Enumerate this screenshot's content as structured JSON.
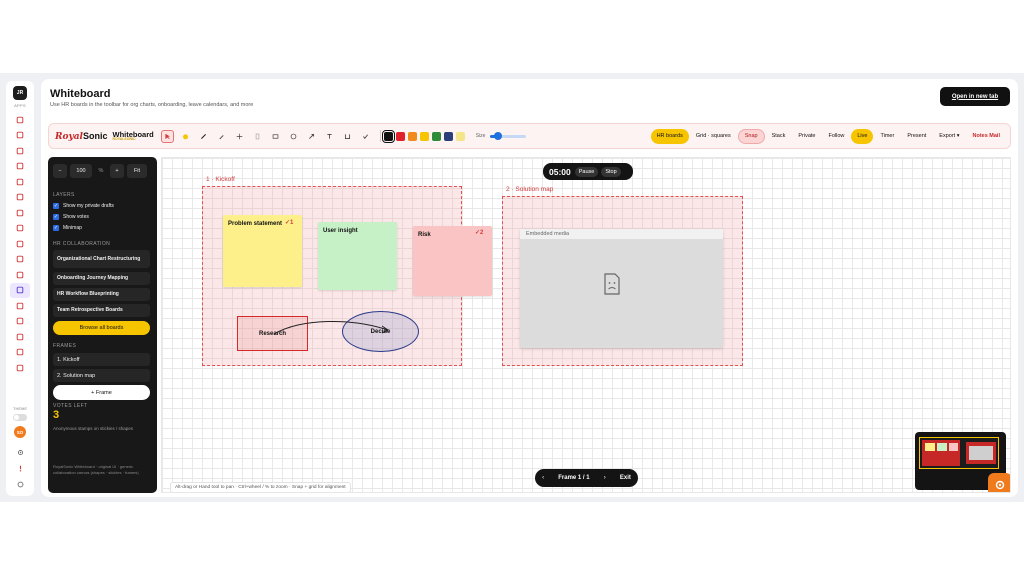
{
  "rail": {
    "avatar": "JR",
    "apps_label": "APPS",
    "icons": [
      "mail-icon",
      "users-icon",
      "calendar-icon",
      "checkbox-icon",
      "bell-icon",
      "inbox-icon",
      "cloud-icon",
      "lock-icon",
      "team-icon",
      "document-icon",
      "list-icon",
      "whiteboard-icon",
      "video-icon",
      "chart-icon",
      "help-icon",
      "grid-icon",
      "notes-icon"
    ],
    "active_index": 11,
    "theme_label": "THEME",
    "user_initials": "SO"
  },
  "header": {
    "title": "Whiteboard",
    "subtitle": "Use HR boards in the toolbar for org charts, onboarding, leave calendars, and more",
    "open_new_tab": "Open in new tab"
  },
  "toolbar": {
    "logo_royal": "Royal",
    "logo_sonic": "Sonic",
    "brand_title": "Whiteboard",
    "brand_sub": "ROYALSONIC",
    "size_label": "Size",
    "size_value": 0.15,
    "swatches": [
      "#111111",
      "#e0202a",
      "#f08a1c",
      "#f7c400",
      "#2e8b3a",
      "#2a3f7a",
      "#f5e58a"
    ],
    "active_swatch": 0,
    "buttons": {
      "hr_boards": "HR boards",
      "grid": "Grid · squares",
      "snap": "Snap",
      "stack": "Stack",
      "private": "Private",
      "follow": "Follow",
      "live": "Live",
      "timer": "Timer",
      "present": "Present",
      "export": "Export ▾",
      "notes_mail": "Notes Mail"
    }
  },
  "sidebar": {
    "zoom_minus": "−",
    "zoom_value": "100",
    "zoom_pct": "%",
    "zoom_plus": "+",
    "fit": "Fit",
    "layers_label": "LAYERS",
    "layers": [
      "Show my private drafts",
      "Show votes",
      "Minimap"
    ],
    "hr_label": "HR COLLABORATION",
    "templates": [
      "Organizational Chart Restructuring",
      "Onboarding Journey Mapping",
      "HR Workflow Blueprinting",
      "Team Retrospective Boards"
    ],
    "browse": "Browse all boards",
    "frames_label": "FRAMES",
    "frames": [
      "1. Kickoff",
      "2. Solution map"
    ],
    "add_frame": "+ Frame",
    "votes_label": "VOTES LEFT",
    "votes_left": "3",
    "votes_help": "Anonymous stamps on stickies / shapes",
    "footer": "RoyalSonic Whiteboard · original UI · generic collaboration canvas (shapes · stickies · frames)"
  },
  "canvas": {
    "timer": "05:00",
    "pause": "Pause",
    "stop": "Stop",
    "frame1_label": "1 · Kickoff",
    "frame2_label": "2 · Solution map",
    "stickies": {
      "problem": "Problem statement",
      "problem_votes": "✓1",
      "user_insight": "User insight",
      "risk": "Risk",
      "risk_votes": "✓2"
    },
    "research": "Research",
    "decide": "Decide",
    "embedded": "Embedded media",
    "hint": "Alt-drag or Hand tool to pan · Ctrl+wheel / % to zoom · Snap + grid for alignment",
    "frame_nav_label": "Frame 1 / 1",
    "frame_nav_prev": "‹",
    "frame_nav_next": "›",
    "exit": "Exit"
  },
  "colors": {
    "accent": "#f7c400",
    "brand_red": "#c62828",
    "frame_dash": "#e05252",
    "sticky_yellow": "#fdf08a",
    "sticky_green": "#c6f0c6",
    "sticky_pink": "#fbc4c4"
  }
}
